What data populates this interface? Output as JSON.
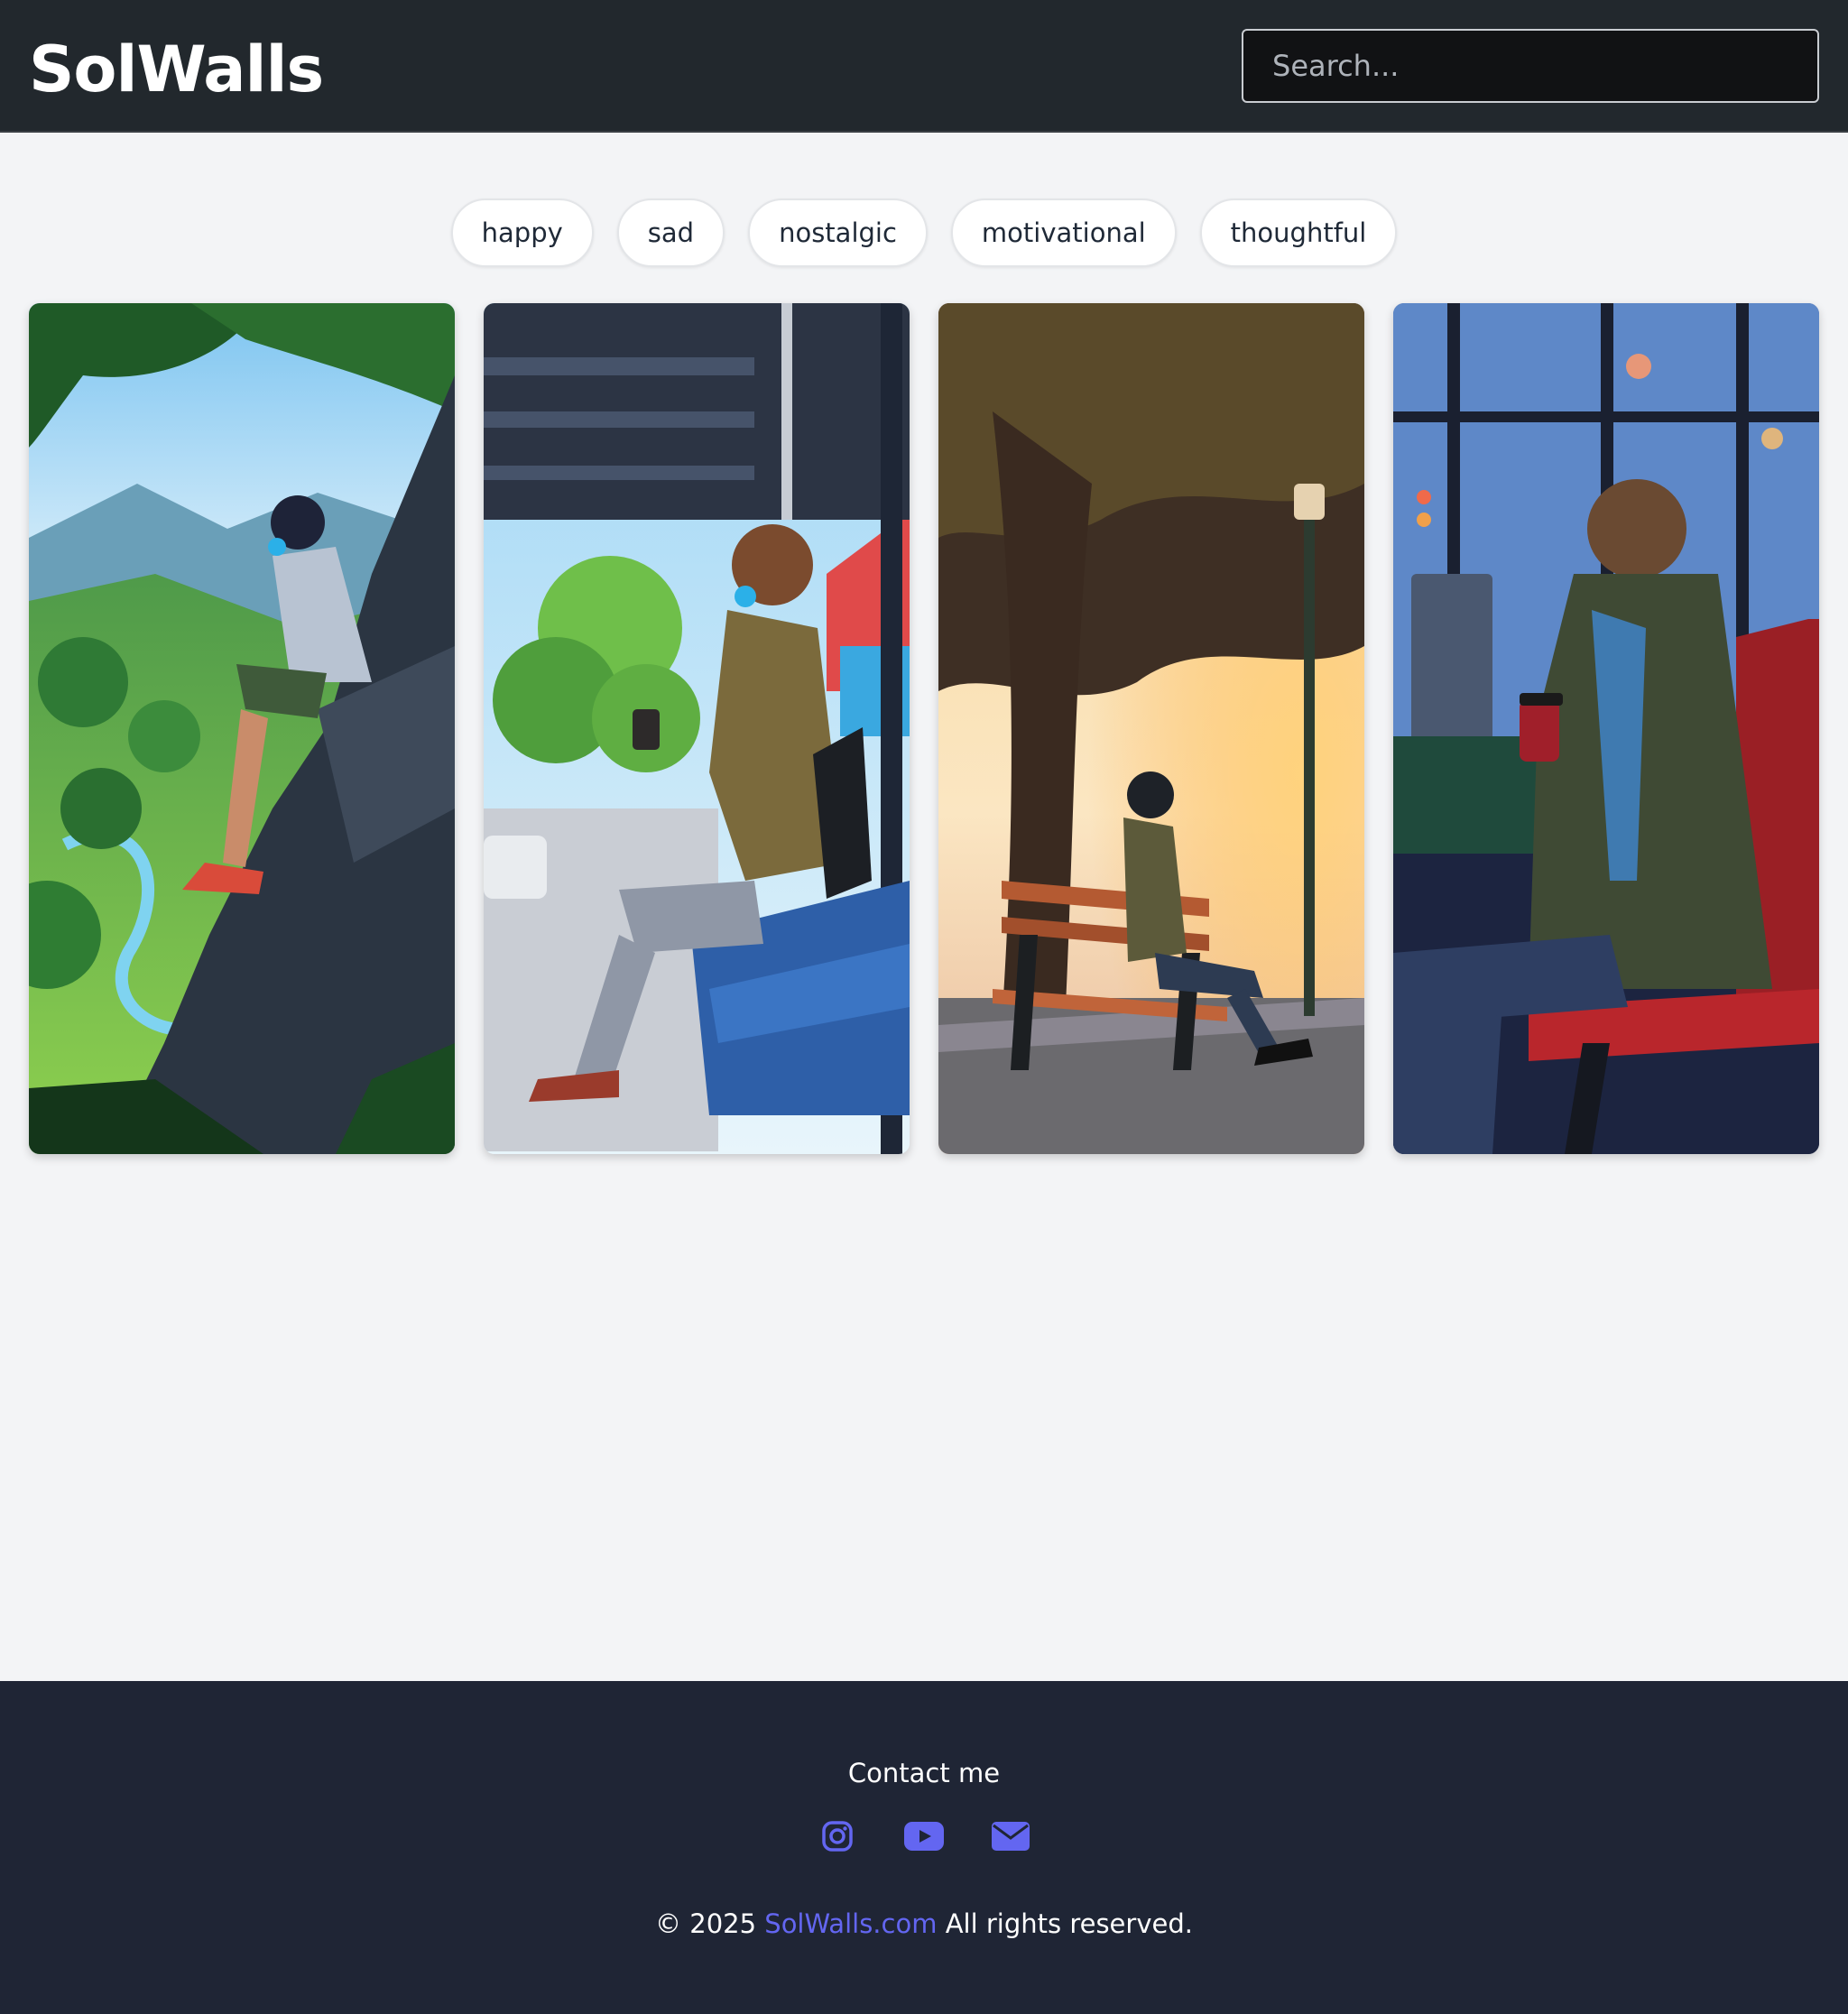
{
  "header": {
    "logo": "SolWalls",
    "search_placeholder": "Search..."
  },
  "moods": [
    "happy",
    "sad",
    "nostalgic",
    "motivational",
    "thoughtful"
  ],
  "wallpapers": [
    {
      "scene": "boy with headphones sitting on cliff overlooking green valley"
    },
    {
      "scene": "boy with headphones and coffee at bus stop"
    },
    {
      "scene": "boy on park bench at sunset under tree"
    },
    {
      "scene": "boy with red coffee cup on rainy bus seat"
    }
  ],
  "footer": {
    "contact": "Contact me",
    "icons": [
      "instagram-icon",
      "youtube-icon",
      "email-icon"
    ],
    "copyright_prefix": "© 2025",
    "brand": "SolWalls.com",
    "copyright_suffix": "All rights reserved."
  },
  "colors": {
    "header_bg": "#22282d",
    "page_bg": "#f3f4f6",
    "footer_bg": "#1f2535",
    "accent": "#6366f1"
  }
}
